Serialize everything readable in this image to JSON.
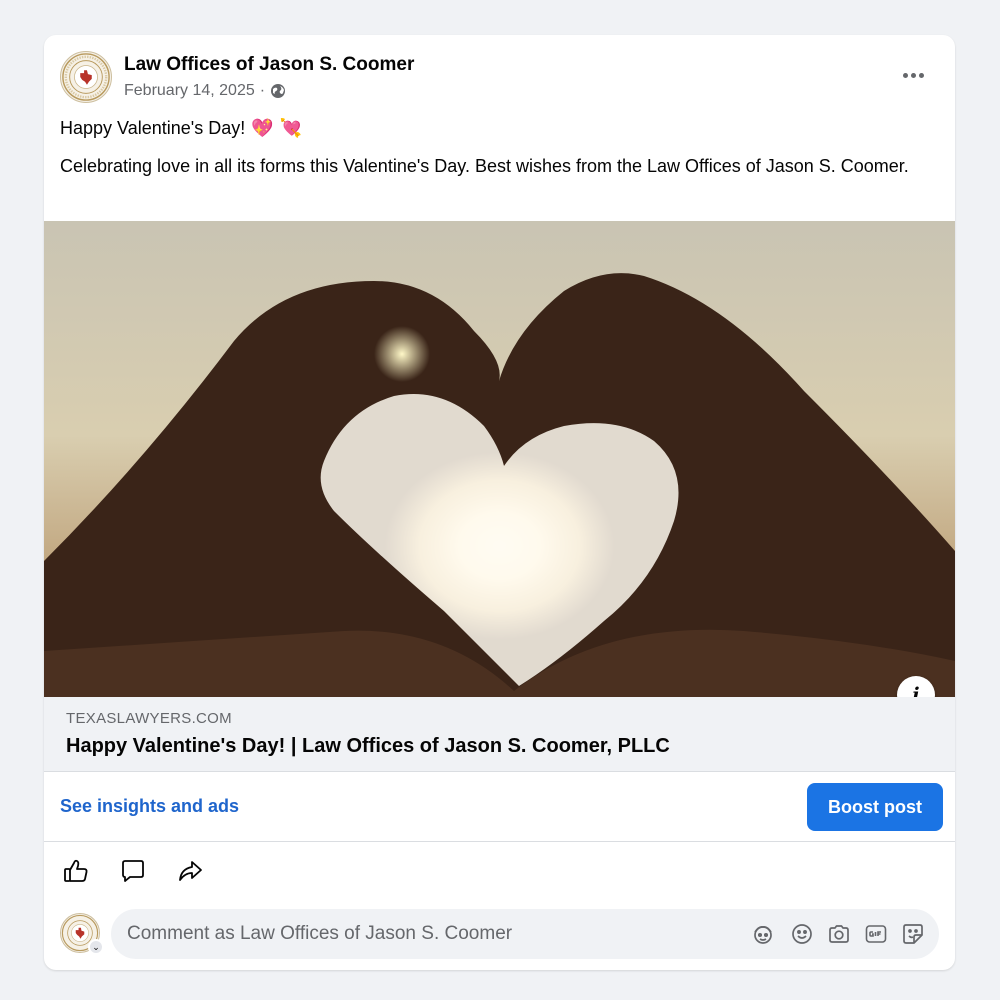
{
  "post": {
    "author": "Law Offices of Jason S. Coomer",
    "date": "February 14, 2025",
    "separator": "·",
    "audience_icon": "globe-icon",
    "more_icon": "more-options-icon",
    "text_line1": "Happy Valentine's Day!",
    "text_line1_emojis": [
      "💖",
      "💘"
    ],
    "text_body": "Celebrating love in all its forms this Valentine's Day. Best wishes from the Law Offices of Jason S. Coomer."
  },
  "link_preview": {
    "domain": "TEXASLAWYERS.COM",
    "title": "Happy Valentine's Day! | Law Offices of Jason S. Coomer, PLLC",
    "info_icon": "info-icon",
    "info_glyph": "i"
  },
  "insights": {
    "link_label": "See insights and ads",
    "boost_label": "Boost post"
  },
  "actions": {
    "icons": [
      "like-icon",
      "comment-icon",
      "share-icon"
    ]
  },
  "comment": {
    "placeholder": "Comment as Law Offices of Jason S. Coomer",
    "icons": [
      "avatar-sticker-icon",
      "emoji-icon",
      "camera-icon",
      "gif-icon",
      "sticker-icon"
    ]
  },
  "colors": {
    "accent": "#1b74e4",
    "link": "#1f65cc",
    "background": "#f0f2f5"
  }
}
